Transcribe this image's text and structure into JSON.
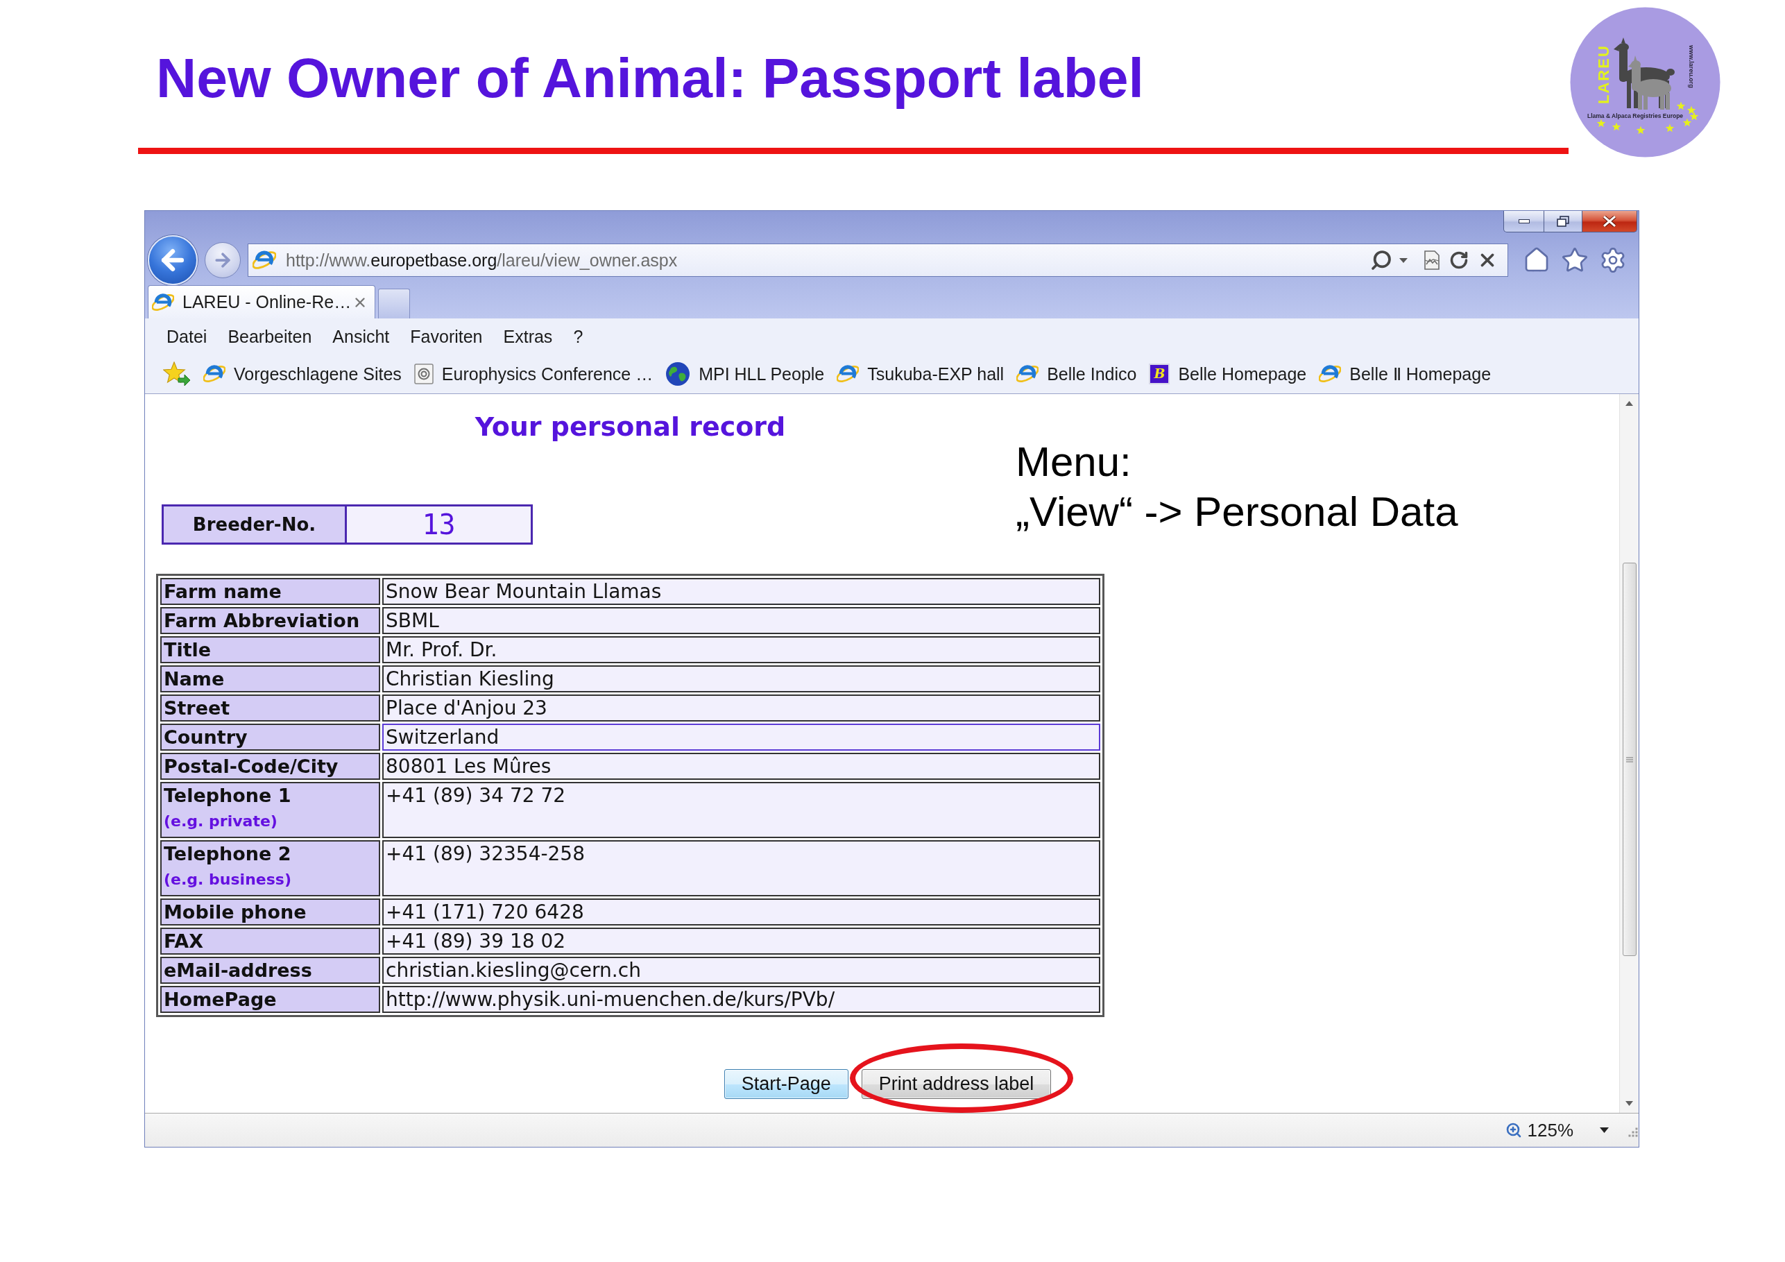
{
  "slide": {
    "title": "New Owner of Animal: Passport label"
  },
  "logo": {
    "name": "LAREU",
    "tagline": "Llama & Alpaca Registries Europe",
    "url": "www.lareu.org"
  },
  "browser": {
    "address_bar": {
      "url_parts": [
        {
          "text": "http://www.",
          "emphasis": false
        },
        {
          "text": "europetbase.org",
          "emphasis": true
        },
        {
          "text": "/lareu/view_owner.aspx",
          "emphasis": false
        }
      ]
    },
    "tabs": [
      {
        "title": "LAREU - Online-Re…",
        "selected": true
      }
    ],
    "menu": [
      "Datei",
      "Bearbeiten",
      "Ansicht",
      "Favoriten",
      "Extras",
      "?"
    ],
    "favorites": [
      {
        "kind": "web",
        "label": "Vorgeschlagene Sites"
      },
      {
        "kind": "document",
        "label": "Europhysics Conference …"
      },
      {
        "kind": "globe",
        "label": "MPI HLL People"
      },
      {
        "kind": "web",
        "label": "Tsukuba-EXP hall"
      },
      {
        "kind": "web",
        "label": "Belle Indico"
      },
      {
        "kind": "letter",
        "letter": "B",
        "label": "Belle Homepage"
      },
      {
        "kind": "web",
        "label": "Belle Ⅱ Homepage"
      }
    ]
  },
  "page": {
    "heading": "Your personal record",
    "breeder": {
      "label": "Breeder-No.",
      "value": "13"
    },
    "table": {
      "rows": [
        {
          "label": "Farm name",
          "value": "Snow Bear Mountain Llamas",
          "highlighted": false
        },
        {
          "label": "Farm Abbreviation",
          "value": "SBML",
          "highlighted": false
        },
        {
          "label": "Title",
          "value": "Mr. Prof. Dr.",
          "highlighted": false
        },
        {
          "label": "Name",
          "value": "Christian Kiesling",
          "highlighted": false
        },
        {
          "label": "Street",
          "value": "Place d'Anjou 23",
          "highlighted": false
        },
        {
          "label": "Country",
          "value": "Switzerland",
          "highlighted": true
        },
        {
          "label": "Postal-Code/City",
          "value": "80801 Les Mûres",
          "highlighted": false
        },
        {
          "label": "Telephone 1",
          "hint": "(e.g. private)",
          "value": "+41 (89) 34 72 72",
          "highlighted": false
        },
        {
          "label": "Telephone 2",
          "hint": "(e.g. business)",
          "value": "+41 (89) 32354-258",
          "highlighted": false
        },
        {
          "label": "Mobile phone",
          "value": "+41 (171) 720 6428",
          "highlighted": false
        },
        {
          "label": "FAX",
          "value": "+41 (89) 39 18 02",
          "highlighted": false
        },
        {
          "label": "eMail-address",
          "value": "christian.kiesling@cern.ch",
          "highlighted": false
        },
        {
          "label": "HomePage",
          "value": "http://www.physik.uni-muenchen.de/kurs/PVb/",
          "highlighted": false
        }
      ]
    },
    "buttons": [
      {
        "label": "Start-Page",
        "focused": true,
        "circled": false
      },
      {
        "label": "Print address label",
        "focused": false,
        "circled": true
      }
    ]
  },
  "annotation": {
    "lines": [
      "Menu:",
      "„View“ -> Personal Data"
    ]
  },
  "status_bar": {
    "zoom": "125%"
  }
}
